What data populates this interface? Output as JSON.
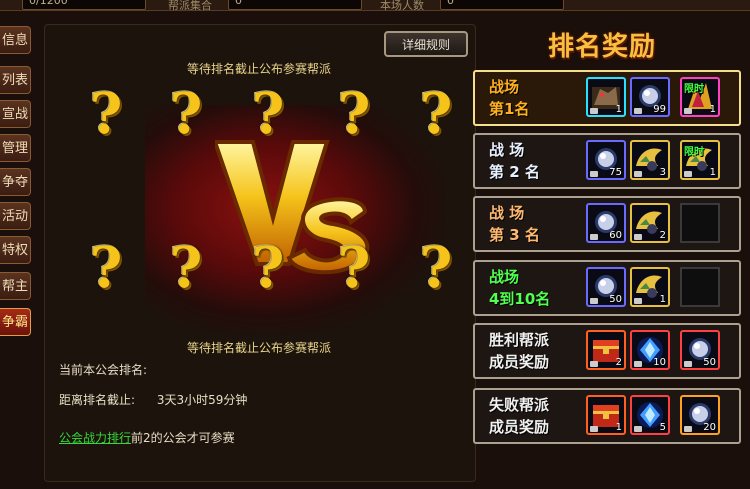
{
  "top": {
    "box1": "0/1200",
    "label2": "帮派集合",
    "box2": "0",
    "label3": "本场人数",
    "box3": "0"
  },
  "sidebar": [
    {
      "label": "信息"
    },
    {
      "label": "列表"
    },
    {
      "label": "宣战"
    },
    {
      "label": "管理"
    },
    {
      "label": "争夺"
    },
    {
      "label": "活动"
    },
    {
      "label": "特权"
    },
    {
      "label": "帮主"
    },
    {
      "label": "争霸",
      "active": true
    }
  ],
  "main": {
    "detail_button": "详细规则",
    "wait_top": "等待排名截止公布参赛帮派",
    "wait_bottom": "等待排名截止公布参赛帮派",
    "rank_label": "当前本公会排名:",
    "rank_value": "",
    "deadline_label": "距离排名截止:",
    "deadline_value": "3天3小时59分钟",
    "qualify_link": "公会战力排行",
    "qualify_text": "前2的公会才可参赛",
    "vs_text": "VS",
    "question": "?"
  },
  "rewards": {
    "title": "排名奖励",
    "rows": [
      {
        "line1": "战场",
        "line2": "第1名",
        "color": "#ffb020",
        "items": [
          {
            "count": "1",
            "kind": "beast",
            "frame": "#2ae0ff"
          },
          {
            "count": "99",
            "kind": "orb",
            "frame": "#6a6aff"
          },
          {
            "count": "1",
            "kind": "wing-red",
            "frame": "#ff40c0",
            "tag": "限时"
          }
        ]
      },
      {
        "line1": "战 场",
        "line2": "第 2 名",
        "color": "#e8f0ff",
        "items": [
          {
            "count": "75",
            "kind": "orb",
            "frame": "#6a6aff"
          },
          {
            "count": "3",
            "kind": "wing-gold",
            "frame": "#e8c040"
          },
          {
            "count": "1",
            "kind": "wing-gold",
            "frame": "#e8c040",
            "tag": "限时"
          }
        ]
      },
      {
        "line1": "战 场",
        "line2": "第 3 名",
        "color": "#ffb870",
        "items": [
          {
            "count": "60",
            "kind": "orb",
            "frame": "#6a6aff"
          },
          {
            "count": "2",
            "kind": "wing-gold",
            "frame": "#e8c040"
          },
          {
            "empty": true
          }
        ]
      },
      {
        "line1": "战场",
        "line2": "4到10名",
        "color": "#50ff50",
        "items": [
          {
            "count": "50",
            "kind": "orb",
            "frame": "#6a6aff"
          },
          {
            "count": "1",
            "kind": "wing-gold",
            "frame": "#e8c040"
          },
          {
            "empty": true
          }
        ]
      },
      {
        "line1": "胜利帮派",
        "line2": "成员奖励",
        "color": "#f0f0f0",
        "items": [
          {
            "count": "2",
            "kind": "chest",
            "frame": "#ff6020"
          },
          {
            "count": "10",
            "kind": "gem-blue",
            "frame": "#ff4040"
          },
          {
            "count": "50",
            "kind": "orb",
            "frame": "#ff4040"
          }
        ]
      },
      {
        "line1": "失败帮派",
        "line2": "成员奖励",
        "color": "#f0f0f0",
        "items": [
          {
            "count": "1",
            "kind": "chest",
            "frame": "#ff6020"
          },
          {
            "count": "5",
            "kind": "gem-blue",
            "frame": "#ff4040"
          },
          {
            "count": "20",
            "kind": "orb",
            "frame": "#ffa020"
          }
        ]
      }
    ]
  }
}
